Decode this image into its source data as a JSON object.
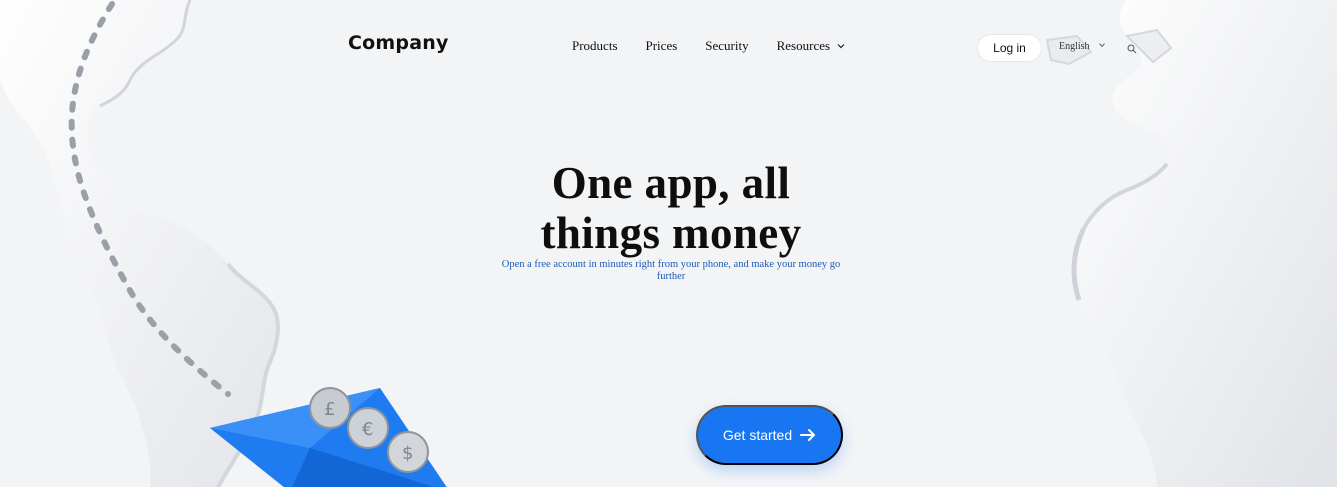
{
  "brand": {
    "logo_text": "Company"
  },
  "nav": {
    "items": [
      {
        "label": "Products",
        "icon": null
      },
      {
        "label": "Prices",
        "icon": null
      },
      {
        "label": "Security",
        "icon": null
      },
      {
        "label": "Resources",
        "icon": "chevron-down-icon"
      }
    ]
  },
  "header": {
    "login_label": "Log in",
    "language_label": "English",
    "language_icon": "chevron-down-icon",
    "search_icon": "search-icon"
  },
  "hero": {
    "title": "One app, all things money",
    "subtitle": "Open a free account in minutes right from your phone, and make your money go further",
    "cta_label": "Get started",
    "cta_icon": "arrow-right-icon"
  },
  "colors": {
    "background": "#f3f4f6",
    "accent": "#1976f2",
    "subtitle_text": "#1e5bb6",
    "headline_text": "#0e0e0e"
  }
}
